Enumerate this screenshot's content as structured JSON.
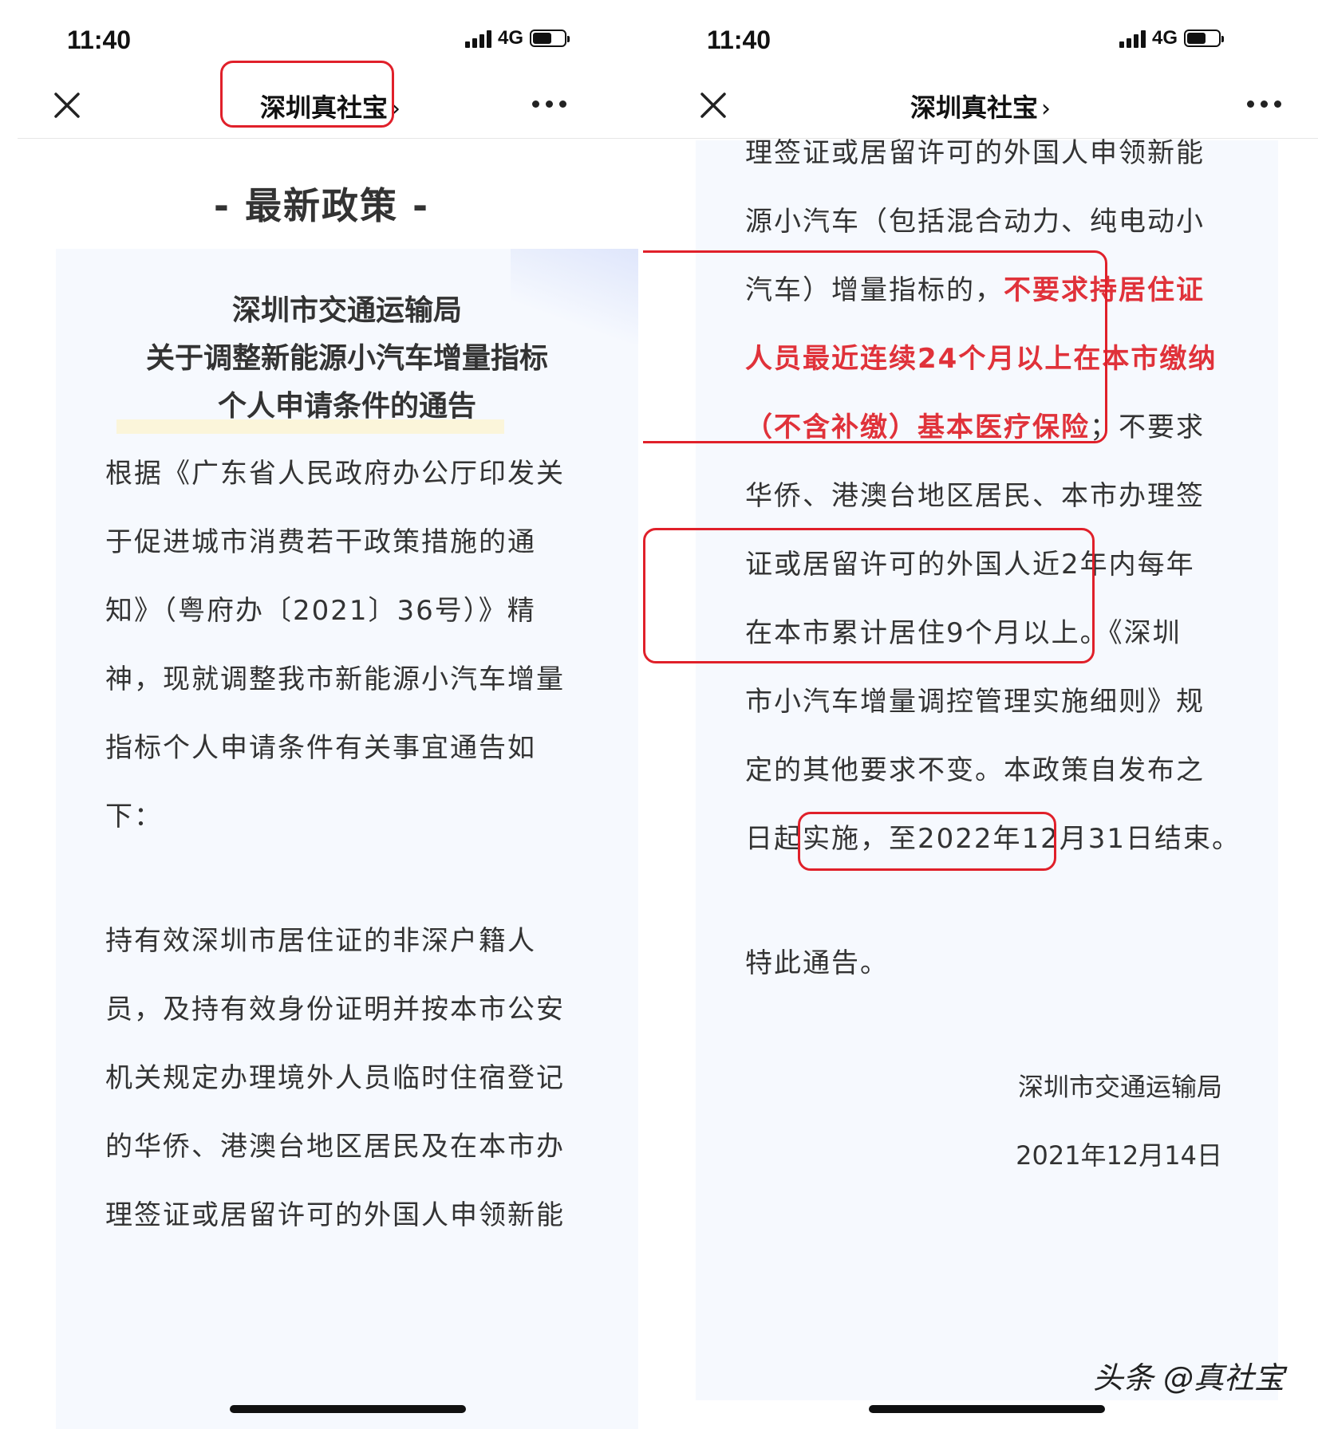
{
  "status_bar": {
    "time": "11:40",
    "network": "4G"
  },
  "nav": {
    "title": "深圳真社宝",
    "chevron": "›"
  },
  "section_title": "- 最新政策 -",
  "notice_heading": [
    "深圳市交通运输局",
    "关于调整新能源小汽车增量指标",
    "个人申请条件的通告"
  ],
  "left_body_para1": [
    "根据《广东省人民政府办公厅印发关",
    "于促进城市消费若干政策措施的通",
    "知》（粤府办〔2021〕36号）》精",
    "神，现就调整我市新能源小汽车增量",
    "指标个人申请条件有关事宜通告如",
    "下："
  ],
  "left_body_para2": [
    "持有效深圳市居住证的非深户籍人",
    "员，及持有效身份证明并按本市公安",
    "机关规定办理境外人员临时住宿登记",
    "的华侨、港澳台地区居民及在本市办",
    "理签证或居留许可的外国人申领新能"
  ],
  "right_body": {
    "line1": "理签证或居留许可的外国人申领新能",
    "line2": "源小汽车（包括混合动力、纯电动小",
    "line3_normal": "汽车）增量指标的，",
    "line3_red": "不要求持居住证",
    "line4_red": "人员最近连续24个月以上在本市缴纳",
    "line5_red": "（不含补缴）基本医疗保险",
    "line5_normal": "；不要求",
    "line6": "华侨、港澳台地区居民、本市办理签",
    "line7": "证或居留许可的外国人近2年内每年",
    "line8": "在本市累计居住9个月以上。《深圳",
    "line9": "市小汽车增量调控管理实施细则》规",
    "line10": "定的其他要求不变。本政策自发布之",
    "line11": "日起实施，至2022年12月31日结束。",
    "closing": "特此通告。",
    "signature": "深圳市交通运输局",
    "date": "2021年12月14日"
  },
  "watermark": "头条 @真社宝",
  "colors": {
    "highlight_red": "#e0202a",
    "card_bg": "#f6f9fe",
    "text": "#333333"
  },
  "icons": [
    "close-icon",
    "more-icon",
    "signal-icon",
    "battery-icon",
    "chevron-right-icon"
  ]
}
